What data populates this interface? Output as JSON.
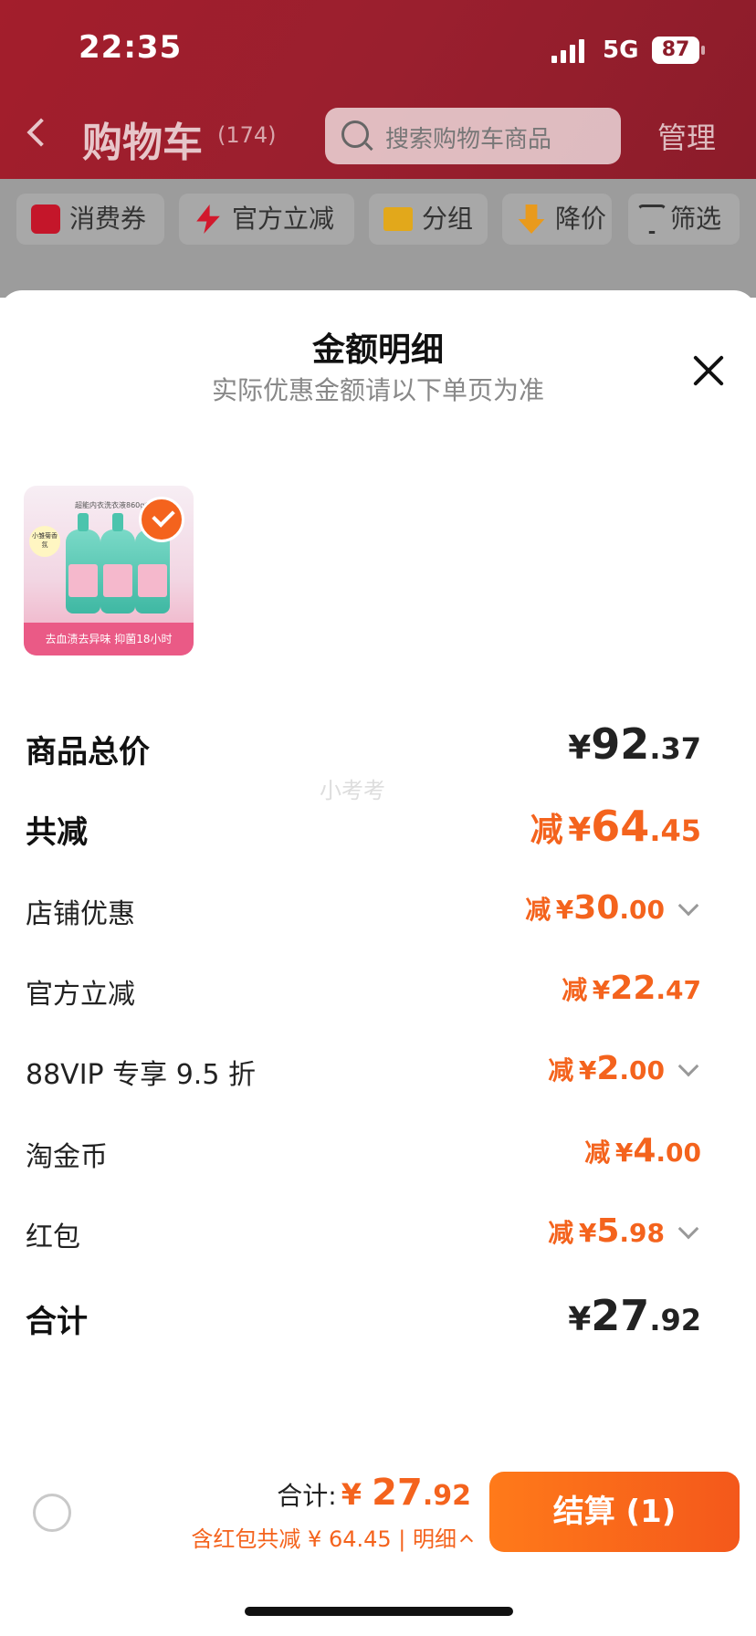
{
  "status_bar": {
    "time": "22:35",
    "network": "5G",
    "battery": "87"
  },
  "header": {
    "title": "购物车",
    "count": "(174)",
    "search_placeholder": "搜索购物车商品",
    "manage": "管理"
  },
  "filters": [
    "消费券",
    "官方立减",
    "分组",
    "降价",
    "筛选"
  ],
  "sheet": {
    "title": "金额明细",
    "subtitle": "实际优惠金额请以下单页为准",
    "product": {
      "thumb_banner": "去血渍去异味 抑菌18小时",
      "thumb_top_text": "超能内衣洗衣液860g*3",
      "thumb_badge": "小雏菊香氛"
    },
    "watermark": "小考考",
    "rows": [
      {
        "label": "商品总价",
        "prefix": "",
        "symbol": "¥",
        "int": "92",
        "dec": ".37"
      },
      {
        "label": "共减",
        "prefix": "减",
        "symbol": "¥",
        "int": "64",
        "dec": ".45"
      },
      {
        "label": "店铺优惠",
        "prefix": "减",
        "symbol": "¥",
        "int": "30",
        "dec": ".00"
      },
      {
        "label": "官方立减",
        "prefix": "减",
        "symbol": "¥",
        "int": "22",
        "dec": ".47"
      },
      {
        "label": "88VIP 专享 9.5 折",
        "prefix": "减",
        "symbol": "¥",
        "int": "2",
        "dec": ".00"
      },
      {
        "label": "淘金币",
        "prefix": "减",
        "symbol": "¥",
        "int": "4",
        "dec": ".00"
      },
      {
        "label": "红包",
        "prefix": "减",
        "symbol": "¥",
        "int": "5",
        "dec": ".98"
      },
      {
        "label": "合计",
        "prefix": "",
        "symbol": "¥",
        "int": "27",
        "dec": ".92"
      }
    ]
  },
  "bottom_bar": {
    "total_label": "合计:",
    "total_symbol": "¥ ",
    "total_int": "27",
    "total_dec": ".92",
    "discount_text": "含红包共减 ¥ 64.45 | 明细",
    "checkout": "结算 (1)"
  },
  "colors": {
    "accent": "#f4631d",
    "header_red": "#9a1f2e"
  }
}
